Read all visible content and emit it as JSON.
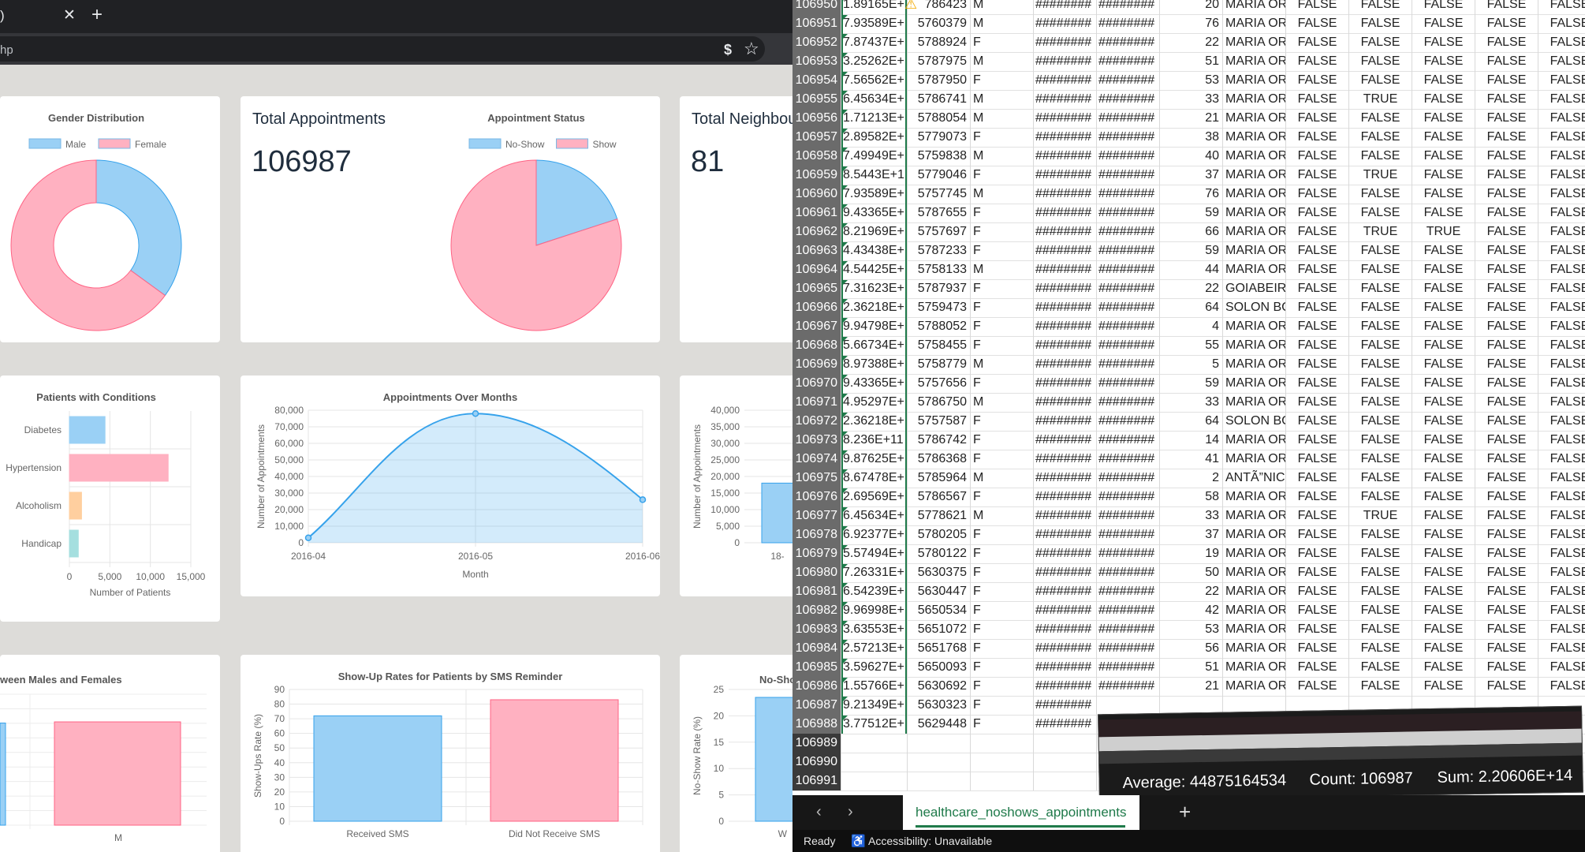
{
  "browser": {
    "tab_text": ")",
    "tab_close": "✕",
    "new_tab": "+",
    "url": "hp",
    "pay_icon": "$",
    "star_icon": "☆"
  },
  "dashboard": {
    "total_appointments": {
      "title": "Total Appointments",
      "value": "106987"
    },
    "total_neighbourhoods": {
      "title": "Total Neighbou",
      "value": "81"
    },
    "gender_chart": {
      "chart_data": {
        "type": "pie",
        "title": "Gender Distribution",
        "legend": [
          "Male",
          "Female"
        ],
        "values": [
          35,
          65
        ],
        "colors": [
          "#9ad0f5",
          "#ffb1c1"
        ],
        "legend_position": "top"
      }
    },
    "status_chart": {
      "chart_data": {
        "type": "pie",
        "title": "Appointment Status",
        "legend": [
          "No-Show",
          "Show"
        ],
        "values": [
          20,
          80
        ],
        "colors": [
          "#9ad0f5",
          "#ffb1c1"
        ],
        "legend_position": "top"
      }
    },
    "conditions_chart": {
      "chart_data": {
        "type": "bar",
        "orientation": "horizontal",
        "title": "Patients with Conditions",
        "categories": [
          "Diabetes",
          "Hypertension",
          "Alcoholism",
          "Handicap"
        ],
        "values": [
          4400,
          12200,
          1500,
          1100
        ],
        "colors": [
          "#9ad0f5",
          "#ffb1c1",
          "#ffcf9f",
          "#a5dfdf"
        ],
        "xlabel": "Number of Patients",
        "xlim": [
          0,
          15000
        ],
        "xticks": [
          "0",
          "5,000",
          "10,000",
          "15,000"
        ]
      }
    },
    "months_chart": {
      "chart_data": {
        "type": "area",
        "title": "Appointments Over Months",
        "categories": [
          "2016-04",
          "2016-05",
          "2016-06"
        ],
        "values": [
          3000,
          78000,
          26000
        ],
        "xlabel": "Month",
        "ylabel": "Number of Appointments",
        "ylim": [
          0,
          80000
        ],
        "yticks": [
          "0",
          "10,000",
          "20,000",
          "30,000",
          "40,000",
          "50,000",
          "60,000",
          "70,000",
          "80,000"
        ]
      }
    },
    "neighbourhood_chart": {
      "chart_data": {
        "type": "bar",
        "title": "",
        "categories": [
          "18-"
        ],
        "values": [
          18000
        ],
        "ylabel": "Number of Appointments",
        "ylim": [
          0,
          40000
        ],
        "yticks": [
          "0",
          "5,000",
          "10,000",
          "15,000",
          "20,000",
          "25,000",
          "30,000",
          "35,000",
          "40,000"
        ]
      }
    },
    "gender_showup_chart": {
      "chart_data": {
        "type": "bar",
        "title": "ween Males and Females",
        "categories": [
          "M"
        ],
        "values": [
          71
        ],
        "colors": [
          "#ffb1c1"
        ]
      }
    },
    "sms_chart": {
      "chart_data": {
        "type": "bar",
        "title": "Show-Up Rates for Patients by SMS Reminder",
        "categories": [
          "Received SMS",
          "Did Not Receive SMS"
        ],
        "values": [
          72,
          83
        ],
        "colors": [
          "#9ad0f5",
          "#ffb1c1"
        ],
        "ylabel": "Show-Ups Rate (%)",
        "ylim": [
          0,
          90
        ],
        "yticks": [
          "0",
          "10",
          "20",
          "30",
          "40",
          "50",
          "60",
          "70",
          "80",
          "90"
        ]
      }
    },
    "noshow_chart": {
      "chart_data": {
        "type": "bar",
        "title": "No-Sho",
        "categories": [
          "W"
        ],
        "values": [
          23.5
        ],
        "ylabel": "No-Show Rate (%)",
        "ylim": [
          0,
          25
        ],
        "yticks": [
          "0",
          "5",
          "10",
          "15",
          "20",
          "25"
        ]
      }
    }
  },
  "sheet": {
    "rows": [
      [
        "106950",
        "1.89165E+",
        "786423",
        "M",
        "########",
        "########",
        "20",
        "MARIA OR",
        "FALSE",
        "FALSE",
        "FALSE",
        "FALSE",
        "FALSE"
      ],
      [
        "106951",
        "7.93589E+",
        "5760379",
        "M",
        "########",
        "########",
        "76",
        "MARIA OR",
        "FALSE",
        "FALSE",
        "FALSE",
        "FALSE",
        "FALSE"
      ],
      [
        "106952",
        "7.87437E+",
        "5788924",
        "F",
        "########",
        "########",
        "22",
        "MARIA OR",
        "FALSE",
        "FALSE",
        "FALSE",
        "FALSE",
        "FALSE"
      ],
      [
        "106953",
        "3.25262E+",
        "5787975",
        "M",
        "########",
        "########",
        "51",
        "MARIA OR",
        "FALSE",
        "FALSE",
        "FALSE",
        "FALSE",
        "FALSE"
      ],
      [
        "106954",
        "7.56562E+",
        "5787950",
        "F",
        "########",
        "########",
        "53",
        "MARIA OR",
        "FALSE",
        "FALSE",
        "FALSE",
        "FALSE",
        "FALSE"
      ],
      [
        "106955",
        "6.45634E+",
        "5786741",
        "M",
        "########",
        "########",
        "33",
        "MARIA OR",
        "FALSE",
        "TRUE",
        "FALSE",
        "FALSE",
        "FALSE"
      ],
      [
        "106956",
        "1.71213E+",
        "5788054",
        "M",
        "########",
        "########",
        "21",
        "MARIA OR",
        "FALSE",
        "FALSE",
        "FALSE",
        "FALSE",
        "FALSE"
      ],
      [
        "106957",
        "2.89582E+",
        "5779073",
        "F",
        "########",
        "########",
        "38",
        "MARIA OR",
        "FALSE",
        "FALSE",
        "FALSE",
        "FALSE",
        "FALSE"
      ],
      [
        "106958",
        "7.49949E+",
        "5759838",
        "M",
        "########",
        "########",
        "40",
        "MARIA OR",
        "FALSE",
        "FALSE",
        "FALSE",
        "FALSE",
        "FALSE"
      ],
      [
        "106959",
        "8.5443E+1",
        "5779046",
        "F",
        "########",
        "########",
        "37",
        "MARIA OR",
        "FALSE",
        "TRUE",
        "FALSE",
        "FALSE",
        "FALSE"
      ],
      [
        "106960",
        "7.93589E+",
        "5757745",
        "M",
        "########",
        "########",
        "76",
        "MARIA OR",
        "FALSE",
        "FALSE",
        "FALSE",
        "FALSE",
        "FALSE"
      ],
      [
        "106961",
        "9.43365E+",
        "5787655",
        "F",
        "########",
        "########",
        "59",
        "MARIA OR",
        "FALSE",
        "FALSE",
        "FALSE",
        "FALSE",
        "FALSE"
      ],
      [
        "106962",
        "8.21969E+",
        "5757697",
        "F",
        "########",
        "########",
        "66",
        "MARIA OR",
        "FALSE",
        "TRUE",
        "TRUE",
        "FALSE",
        "FALSE"
      ],
      [
        "106963",
        "4.43438E+",
        "5787233",
        "F",
        "########",
        "########",
        "59",
        "MARIA OR",
        "FALSE",
        "FALSE",
        "FALSE",
        "FALSE",
        "FALSE"
      ],
      [
        "106964",
        "4.54425E+",
        "5758133",
        "M",
        "########",
        "########",
        "44",
        "MARIA OR",
        "FALSE",
        "FALSE",
        "FALSE",
        "FALSE",
        "FALSE"
      ],
      [
        "106965",
        "7.31623E+",
        "5787937",
        "F",
        "########",
        "########",
        "22",
        "GOIABEIRA",
        "FALSE",
        "FALSE",
        "FALSE",
        "FALSE",
        "FALSE"
      ],
      [
        "106966",
        "2.36218E+",
        "5759473",
        "F",
        "########",
        "########",
        "64",
        "SOLON BC",
        "FALSE",
        "FALSE",
        "FALSE",
        "FALSE",
        "FALSE"
      ],
      [
        "106967",
        "9.94798E+",
        "5788052",
        "F",
        "########",
        "########",
        "4",
        "MARIA OR",
        "FALSE",
        "FALSE",
        "FALSE",
        "FALSE",
        "FALSE"
      ],
      [
        "106968",
        "5.66734E+",
        "5758455",
        "F",
        "########",
        "########",
        "55",
        "MARIA OR",
        "FALSE",
        "FALSE",
        "FALSE",
        "FALSE",
        "FALSE"
      ],
      [
        "106969",
        "8.97388E+",
        "5758779",
        "M",
        "########",
        "########",
        "5",
        "MARIA OR",
        "FALSE",
        "FALSE",
        "FALSE",
        "FALSE",
        "FALSE"
      ],
      [
        "106970",
        "9.43365E+",
        "5757656",
        "F",
        "########",
        "########",
        "59",
        "MARIA OR",
        "FALSE",
        "FALSE",
        "FALSE",
        "FALSE",
        "FALSE"
      ],
      [
        "106971",
        "4.95297E+",
        "5786750",
        "M",
        "########",
        "########",
        "33",
        "MARIA OR",
        "FALSE",
        "FALSE",
        "FALSE",
        "FALSE",
        "FALSE"
      ],
      [
        "106972",
        "2.36218E+",
        "5757587",
        "F",
        "########",
        "########",
        "64",
        "SOLON BC",
        "FALSE",
        "FALSE",
        "FALSE",
        "FALSE",
        "FALSE"
      ],
      [
        "106973",
        "8.236E+11",
        "5786742",
        "F",
        "########",
        "########",
        "14",
        "MARIA OR",
        "FALSE",
        "FALSE",
        "FALSE",
        "FALSE",
        "FALSE"
      ],
      [
        "106974",
        "9.87625E+",
        "5786368",
        "F",
        "########",
        "########",
        "41",
        "MARIA OR",
        "FALSE",
        "FALSE",
        "FALSE",
        "FALSE",
        "FALSE"
      ],
      [
        "106975",
        "8.67478E+",
        "5785964",
        "M",
        "########",
        "########",
        "2",
        "ANTÃ”NIC",
        "FALSE",
        "FALSE",
        "FALSE",
        "FALSE",
        "FALSE"
      ],
      [
        "106976",
        "2.69569E+",
        "5786567",
        "F",
        "########",
        "########",
        "58",
        "MARIA OR",
        "FALSE",
        "FALSE",
        "FALSE",
        "FALSE",
        "FALSE"
      ],
      [
        "106977",
        "6.45634E+",
        "5778621",
        "M",
        "########",
        "########",
        "33",
        "MARIA OR",
        "FALSE",
        "TRUE",
        "FALSE",
        "FALSE",
        "FALSE"
      ],
      [
        "106978",
        "6.92377E+",
        "5780205",
        "F",
        "########",
        "########",
        "37",
        "MARIA OR",
        "FALSE",
        "FALSE",
        "FALSE",
        "FALSE",
        "FALSE"
      ],
      [
        "106979",
        "5.57494E+",
        "5780122",
        "F",
        "########",
        "########",
        "19",
        "MARIA OR",
        "FALSE",
        "FALSE",
        "FALSE",
        "FALSE",
        "FALSE"
      ],
      [
        "106980",
        "7.26331E+",
        "5630375",
        "F",
        "########",
        "########",
        "50",
        "MARIA OR",
        "FALSE",
        "FALSE",
        "FALSE",
        "FALSE",
        "FALSE"
      ],
      [
        "106981",
        "6.54239E+",
        "5630447",
        "F",
        "########",
        "########",
        "22",
        "MARIA OR",
        "FALSE",
        "FALSE",
        "FALSE",
        "FALSE",
        "FALSE"
      ],
      [
        "106982",
        "9.96998E+",
        "5650534",
        "F",
        "########",
        "########",
        "42",
        "MARIA OR",
        "FALSE",
        "FALSE",
        "FALSE",
        "FALSE",
        "FALSE"
      ],
      [
        "106983",
        "3.63553E+",
        "5651072",
        "F",
        "########",
        "########",
        "53",
        "MARIA OR",
        "FALSE",
        "FALSE",
        "FALSE",
        "FALSE",
        "FALSE"
      ],
      [
        "106984",
        "2.57213E+",
        "5651768",
        "F",
        "########",
        "########",
        "56",
        "MARIA OR",
        "FALSE",
        "FALSE",
        "FALSE",
        "FALSE",
        "FALSE"
      ],
      [
        "106985",
        "3.59627E+",
        "5650093",
        "F",
        "########",
        "########",
        "51",
        "MARIA OR",
        "FALSE",
        "FALSE",
        "FALSE",
        "FALSE",
        "FALSE"
      ],
      [
        "106986",
        "1.55766E+",
        "5630692",
        "F",
        "########",
        "########",
        "21",
        "MARIA OR",
        "FALSE",
        "FALSE",
        "FALSE",
        "FALSE",
        "FALSE"
      ],
      [
        "106987",
        "9.21349E+",
        "5630323",
        "F",
        "########",
        "",
        "",
        "",
        "",
        "",
        "",
        "",
        ""
      ],
      [
        "106988",
        "3.77512E+",
        "5629448",
        "F",
        "########",
        "",
        "",
        "",
        "",
        "",
        "",
        "",
        ""
      ],
      [
        "106989",
        "",
        "",
        "",
        "",
        "",
        "",
        "",
        "",
        "",
        "",
        "",
        ""
      ],
      [
        "106990",
        "",
        "",
        "",
        "",
        "",
        "",
        "",
        "",
        "",
        "",
        "",
        ""
      ],
      [
        "106991",
        "",
        "",
        "",
        "",
        "",
        "",
        "",
        "",
        "",
        "",
        "",
        ""
      ]
    ],
    "warning_icon": "⚠",
    "summary": {
      "average": "Average: 44875164534",
      "count": "Count: 106987",
      "sum": "Sum: 2.20606E+14"
    },
    "sheet_tab": "healthcare_noshows_appointments",
    "add_sheet": "+",
    "nav_prev": "‹",
    "nav_next": "›",
    "status": {
      "ready": "Ready",
      "accessibility": "Accessibility: Unavailable",
      "accessibility_icon": "♿"
    }
  }
}
